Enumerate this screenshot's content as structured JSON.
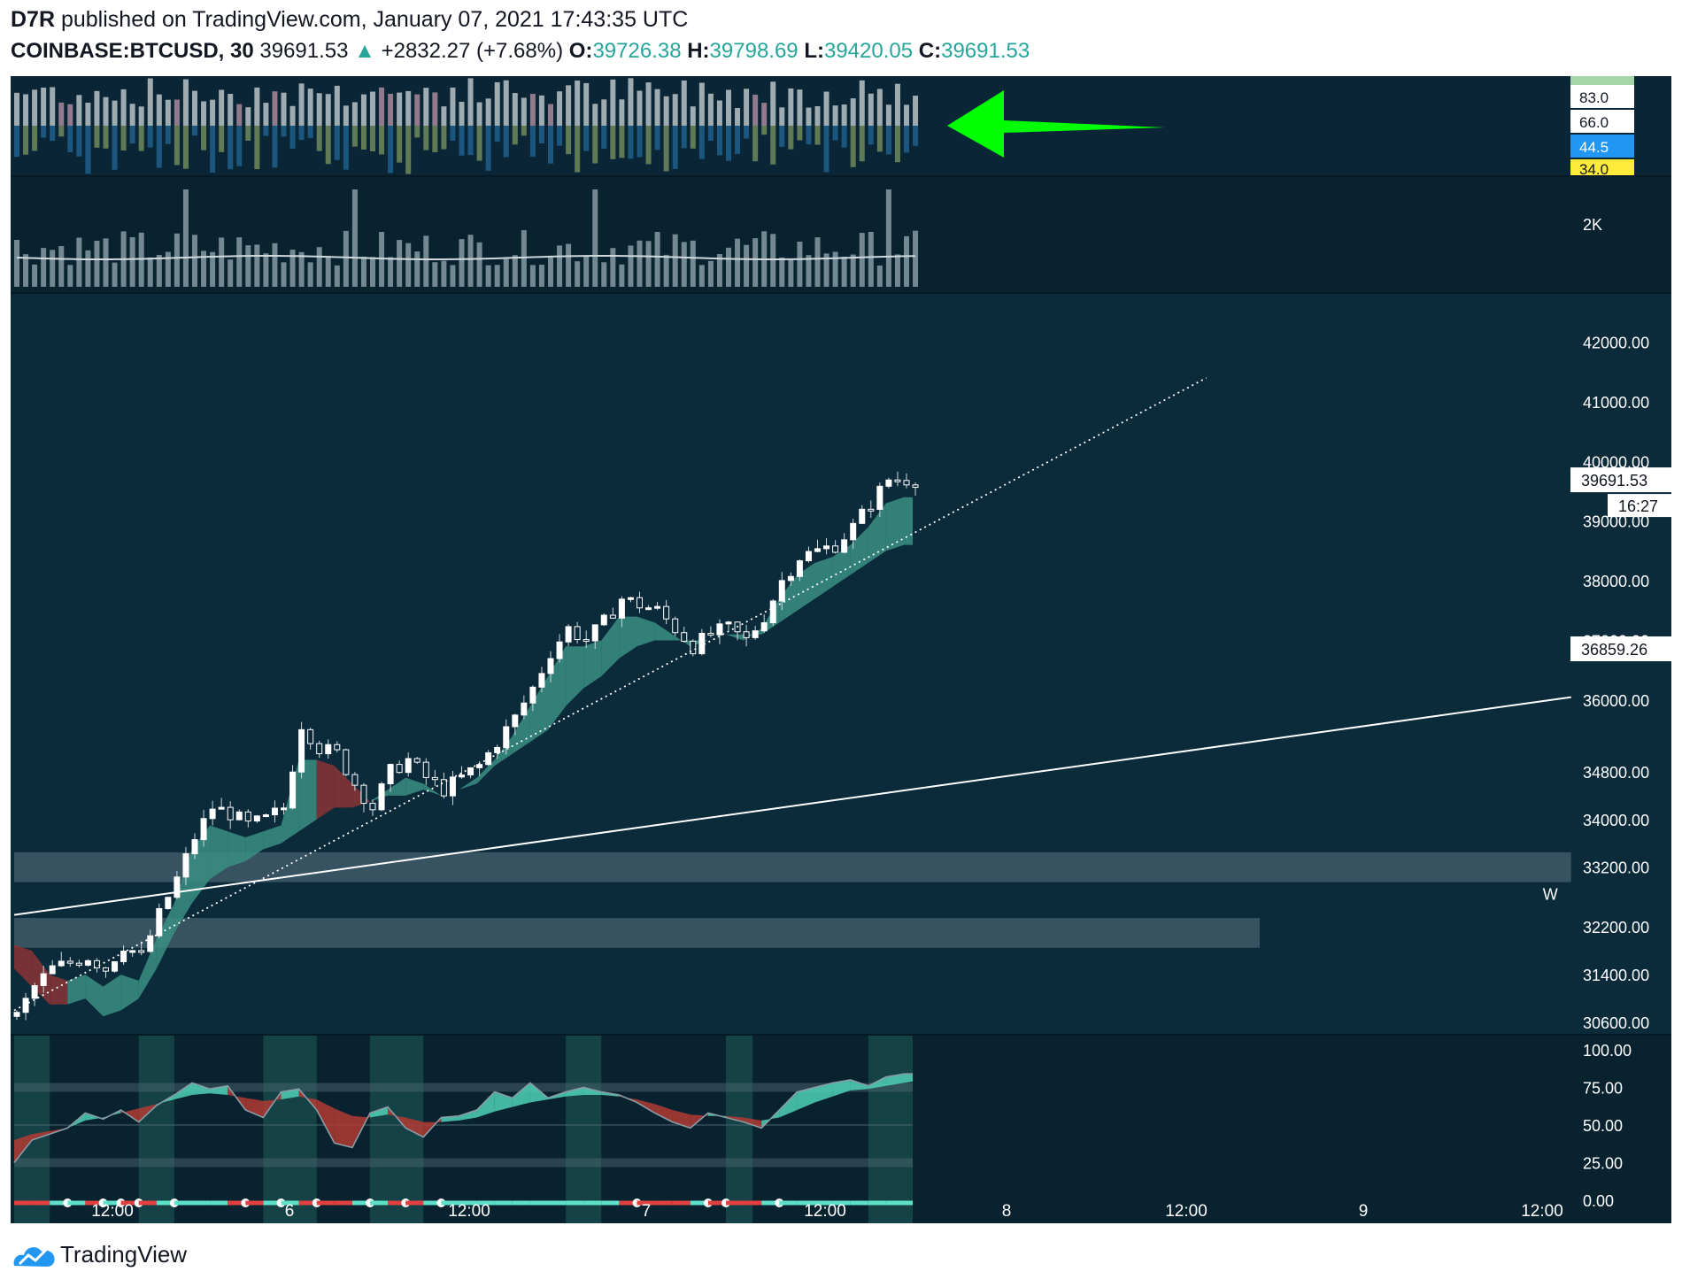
{
  "header": {
    "author": "D7R",
    "published_text": "published on TradingView.com, January 07, 2021 17:43:35 UTC",
    "symbol": "COINBASE:BTCUSD, 30",
    "last": "39691.53",
    "change": "+2832.27 (+7.68%)",
    "o_label": "O:",
    "o": "39726.38",
    "h_label": "H:",
    "h": "39798.69",
    "l_label": "L:",
    "l": "39420.05",
    "c_label": "C:",
    "c": "39691.53"
  },
  "footer": {
    "brand": "TradingView"
  },
  "colors": {
    "background": "#0b2a3a",
    "panel_dark": "#082230",
    "up": "#26a69a",
    "cloud_up": "#3a8f84",
    "cloud_down": "#8a3434",
    "price_line": "#ffffff",
    "arrow": "#00ff00",
    "rsi_up_fill": "#4fd1b8",
    "rsi_down_fill": "#b23a32",
    "dot_line_up": "#5fe0c8",
    "dot_line_down": "#e04040"
  },
  "chart_data": [
    {
      "type": "bar",
      "panel": "oscillator-histogram",
      "y_labels": [
        "83.0",
        "66.0",
        "44.5",
        "34.0"
      ],
      "annotation": "green-arrow-pointing-left"
    },
    {
      "type": "bar",
      "panel": "volume",
      "y_labels": [
        "2K"
      ]
    },
    {
      "type": "line",
      "panel": "price",
      "x_ticks": [
        "12:00",
        "6",
        "12:00",
        "7",
        "12:00",
        "8",
        "12:00",
        "9",
        "12:00"
      ],
      "y_ticks": [
        "42000.00",
        "41000.00",
        "40000.00",
        "39000.00",
        "38000.00",
        "37000.00",
        "36000.00",
        "34800.00",
        "34000.00",
        "33200.00",
        "32200.00",
        "31400.00",
        "30600.00"
      ],
      "y_tick_values": [
        42000,
        41000,
        40000,
        39000,
        38000,
        37000,
        36000,
        34800,
        34000,
        33200,
        32200,
        31400,
        30600
      ],
      "last_price_label": "39691.53",
      "countdown_label": "16:27",
      "level_label": "36859.26",
      "zone_label": "W",
      "x": [
        0,
        2,
        4,
        6,
        8,
        10,
        12,
        14,
        16,
        18,
        20,
        22,
        24,
        26,
        28,
        30,
        32,
        34,
        36,
        38,
        40,
        42,
        44,
        46,
        48,
        50,
        52,
        54,
        56,
        58,
        60,
        62,
        64,
        66,
        68,
        70,
        72,
        74,
        76,
        78,
        80,
        82,
        84,
        86,
        88,
        90,
        92,
        94,
        96,
        98,
        100,
        101
      ],
      "close": [
        30700,
        31200,
        31500,
        31600,
        31700,
        31500,
        31900,
        31700,
        32400,
        33000,
        33700,
        34200,
        34100,
        33900,
        34000,
        34200,
        35600,
        35200,
        35100,
        34600,
        34200,
        34800,
        35000,
        34700,
        34500,
        34700,
        34900,
        35300,
        35700,
        36200,
        36800,
        37200,
        37000,
        37300,
        37700,
        37600,
        37500,
        37200,
        36900,
        37100,
        37200,
        37000,
        37400,
        38000,
        38400,
        38500,
        38600,
        38900,
        39300,
        39700,
        39700,
        39691.53
      ],
      "cloud_top": [
        31900,
        31800,
        31400,
        31300,
        31400,
        31200,
        31400,
        31300,
        32000,
        32600,
        33500,
        33900,
        33800,
        33700,
        33800,
        33900,
        35000,
        35000,
        34900,
        34600,
        34300,
        34500,
        34700,
        34600,
        34400,
        34500,
        34700,
        35000,
        35400,
        35900,
        36400,
        36900,
        36900,
        37000,
        37400,
        37400,
        37300,
        37100,
        36900,
        37000,
        37100,
        37000,
        37200,
        37700,
        38100,
        38300,
        38400,
        38600,
        38900,
        39300,
        39400,
        39400
      ],
      "cloud_bottom": [
        31500,
        31200,
        30900,
        30900,
        31000,
        30700,
        30800,
        31000,
        31500,
        32100,
        32600,
        33000,
        33200,
        33300,
        33500,
        33600,
        33800,
        34000,
        34200,
        34200,
        34300,
        34400,
        34400,
        34500,
        34400,
        34500,
        34600,
        34900,
        35100,
        35300,
        35500,
        35900,
        36200,
        36400,
        36700,
        36900,
        37000,
        37000,
        37000,
        37000,
        37100,
        37100,
        37100,
        37300,
        37500,
        37700,
        37900,
        38100,
        38300,
        38500,
        38600,
        38600
      ],
      "trendline_dotted": {
        "x0": 0,
        "y0": 30800,
        "x1": 134,
        "y1": 41400
      },
      "trendline_solid": {
        "x0": 0,
        "y0": 32400,
        "x1": 175,
        "y1": 36050
      },
      "zones": [
        {
          "y0": 32950,
          "y1": 33450,
          "x_end": 175
        },
        {
          "y0": 31850,
          "y1": 32350,
          "x_end": 140
        }
      ]
    },
    {
      "type": "area",
      "panel": "rsi",
      "y_ticks": [
        "100.00",
        "75.00",
        "50.00",
        "25.00",
        "0.00"
      ],
      "y_tick_values": [
        100,
        75,
        50,
        25,
        0
      ],
      "rsi": [
        25,
        40,
        44,
        48,
        58,
        54,
        60,
        52,
        63,
        70,
        78,
        74,
        76,
        60,
        55,
        72,
        74,
        60,
        38,
        35,
        58,
        62,
        48,
        42,
        55,
        56,
        60,
        72,
        68,
        78,
        68,
        72,
        75,
        72,
        70,
        65,
        58,
        52,
        48,
        58,
        55,
        52,
        48,
        60,
        72,
        75,
        78,
        80,
        76,
        82,
        84,
        84
      ],
      "rsi_ma": [
        40,
        44,
        46,
        48,
        53,
        55,
        58,
        61,
        64,
        67,
        70,
        71,
        70,
        68,
        66,
        67,
        69,
        67,
        61,
        56,
        55,
        57,
        55,
        52,
        52,
        53,
        55,
        59,
        62,
        65,
        67,
        69,
        70,
        70,
        69,
        67,
        64,
        60,
        57,
        56,
        56,
        55,
        53,
        55,
        60,
        65,
        69,
        73,
        74,
        76,
        78,
        79
      ]
    }
  ]
}
